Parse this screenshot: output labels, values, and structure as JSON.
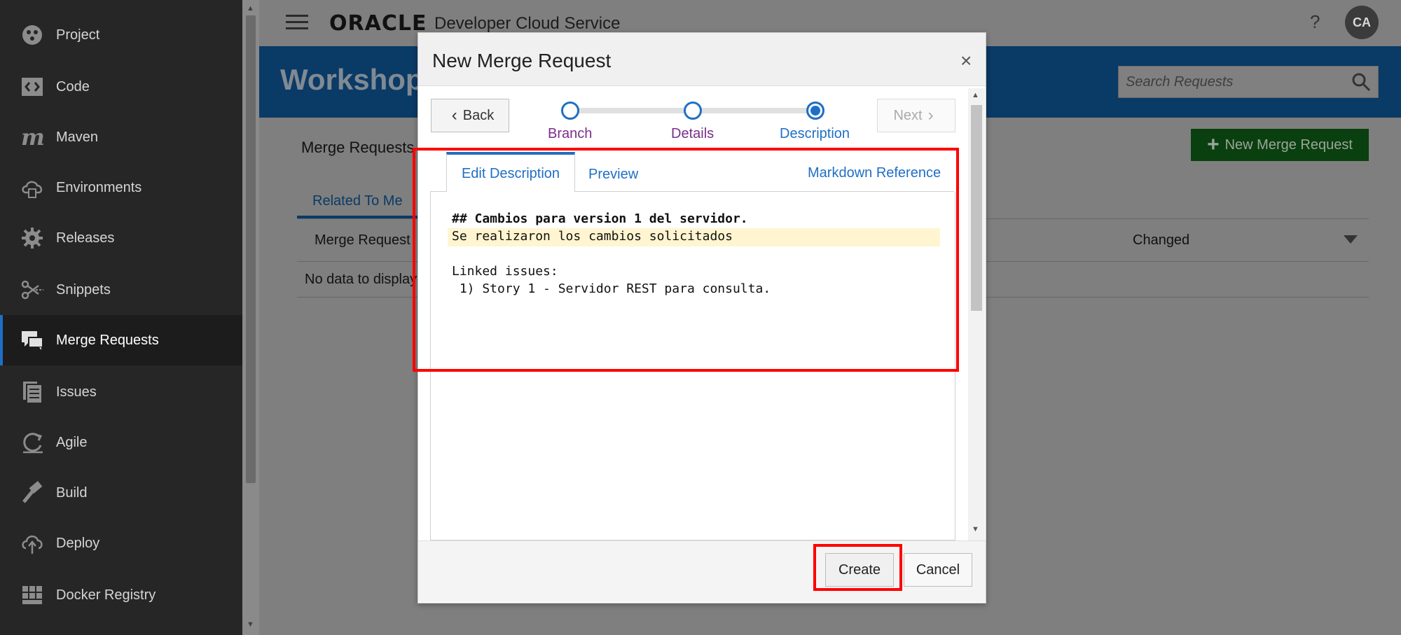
{
  "sidebar": {
    "items": [
      {
        "label": "Project",
        "icon": "project-icon"
      },
      {
        "label": "Code",
        "icon": "code-icon"
      },
      {
        "label": "Maven",
        "icon": "maven-icon"
      },
      {
        "label": "Environments",
        "icon": "environments-icon"
      },
      {
        "label": "Releases",
        "icon": "releases-icon"
      },
      {
        "label": "Snippets",
        "icon": "snippets-icon"
      },
      {
        "label": "Merge Requests",
        "icon": "merge-requests-icon",
        "active": true
      },
      {
        "label": "Issues",
        "icon": "issues-icon"
      },
      {
        "label": "Agile",
        "icon": "agile-icon"
      },
      {
        "label": "Build",
        "icon": "build-icon"
      },
      {
        "label": "Deploy",
        "icon": "deploy-icon"
      },
      {
        "label": "Docker Registry",
        "icon": "docker-registry-icon"
      }
    ]
  },
  "header": {
    "logo": "ORACLE",
    "product": "Developer Cloud Service",
    "help": "?",
    "avatar_initials": "CA"
  },
  "page": {
    "banner_title": "Workshop",
    "search_placeholder": "Search Requests",
    "heading": "Merge Requests",
    "new_button_label": "New Merge Request",
    "related_tab": "Related To Me",
    "table_headers": {
      "merge_request": "Merge Request",
      "changed": "Changed"
    },
    "empty_text": "No data to display"
  },
  "modal": {
    "title": "New Merge Request",
    "close": "×",
    "back_label": "Back",
    "next_label": "Next",
    "train": [
      {
        "label": "Branch",
        "state": "visited"
      },
      {
        "label": "Details",
        "state": "visited"
      },
      {
        "label": "Description",
        "state": "current"
      }
    ],
    "tabs": {
      "edit": "Edit Description",
      "preview": "Preview"
    },
    "markdown_reference": "Markdown Reference",
    "editor_lines": [
      "## Cambios para version 1 del servidor.",
      "Se realizaron los cambios solicitados",
      "",
      "Linked issues:",
      " 1) Story 1 - Servidor REST para consulta."
    ],
    "create_label": "Create",
    "cancel_label": "Cancel"
  },
  "colors": {
    "accent_blue": "#1f6fc5",
    "annotation_red": "#ff0000",
    "train_visited_label": "#7b2d8b",
    "sidebar_bg": "#262626",
    "overlay_gray": "#7f7f7f"
  }
}
